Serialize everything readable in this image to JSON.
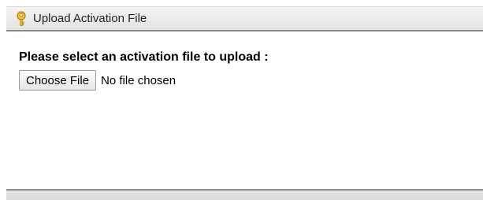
{
  "panel": {
    "title": "Upload Activation File",
    "title_icon": "key-icon"
  },
  "form": {
    "prompt": "Please select an activation file to upload :",
    "choose_file_label": "Choose File",
    "file_status": "No file chosen"
  },
  "colors": {
    "key_icon": "#e0a800",
    "titlebar_border": "#8c8c8c"
  }
}
